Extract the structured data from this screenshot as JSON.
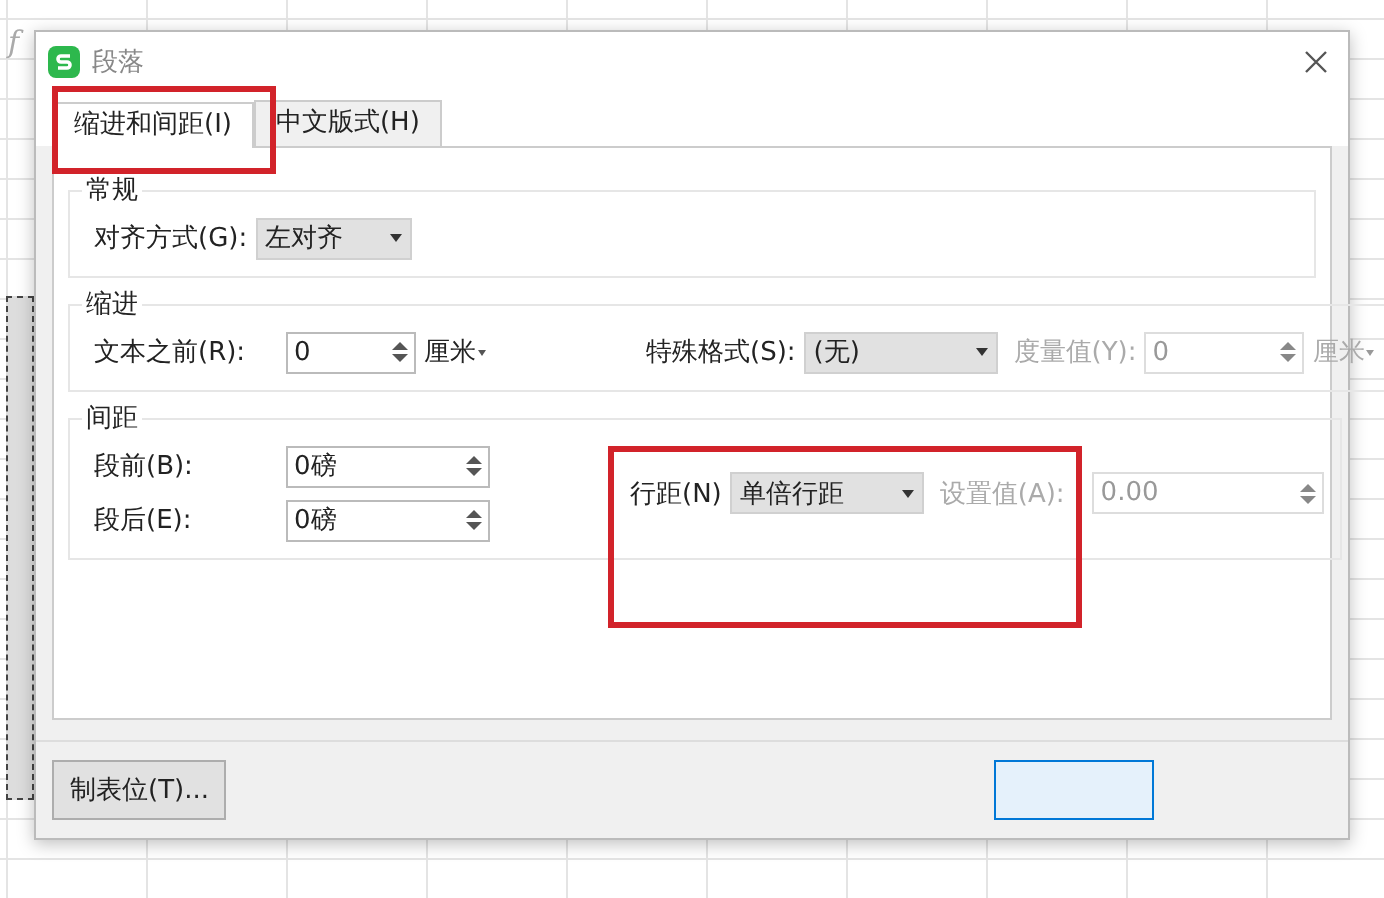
{
  "formula_bar": {
    "label": "f"
  },
  "window": {
    "title": "段落"
  },
  "tabs": [
    {
      "label": "缩进和间距(I)",
      "selected": true
    },
    {
      "label": "中文版式(H)",
      "selected": false
    }
  ],
  "general": {
    "title": "常规",
    "alignment": {
      "label": "对齐方式(G):",
      "value": "左对齐"
    }
  },
  "indent": {
    "title": "缩进",
    "before_text": {
      "label": "文本之前(R):",
      "value": "0",
      "unit": "厘米",
      "disabled": false
    },
    "special": {
      "label": "特殊格式(S):",
      "value": "(无)"
    },
    "measure": {
      "label": "度量值(Y):",
      "value": "0",
      "unit": "厘米",
      "disabled": true
    }
  },
  "spacing": {
    "title": "间距",
    "before": {
      "label": "段前(B):",
      "value": "0磅"
    },
    "after": {
      "label": "段后(E):",
      "value": "0磅"
    },
    "line": {
      "label": "行距(N)",
      "value": "单倍行距"
    },
    "setting": {
      "label": "设置值(A):",
      "value": "0.00",
      "disabled": true
    }
  },
  "buttons": [
    {
      "label": "制表位(T)..."
    }
  ]
}
